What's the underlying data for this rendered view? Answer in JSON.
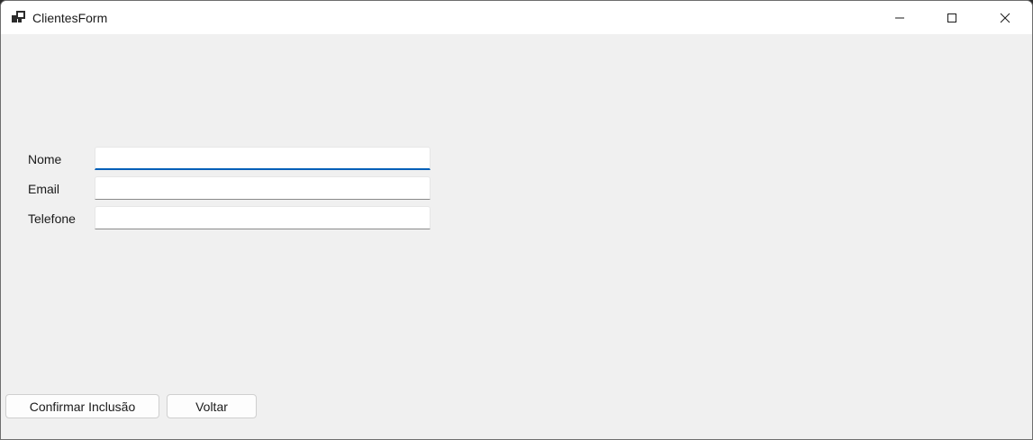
{
  "window": {
    "title": "ClientesForm",
    "app_icon": "windows-form-icon",
    "controls": [
      "minimize-icon",
      "maximize-icon",
      "close-icon"
    ]
  },
  "form": {
    "fields": [
      {
        "label": "Nome",
        "value": "",
        "focused": true
      },
      {
        "label": "Email",
        "value": "",
        "focused": false
      },
      {
        "label": "Telefone",
        "value": "",
        "focused": false
      }
    ]
  },
  "buttons": {
    "confirm_label": "Confirmar Inclusão",
    "back_label": "Voltar"
  },
  "colors": {
    "focus_accent": "#005fb8",
    "form_background": "#f0f0f0",
    "titlebar_background": "#ffffff"
  }
}
